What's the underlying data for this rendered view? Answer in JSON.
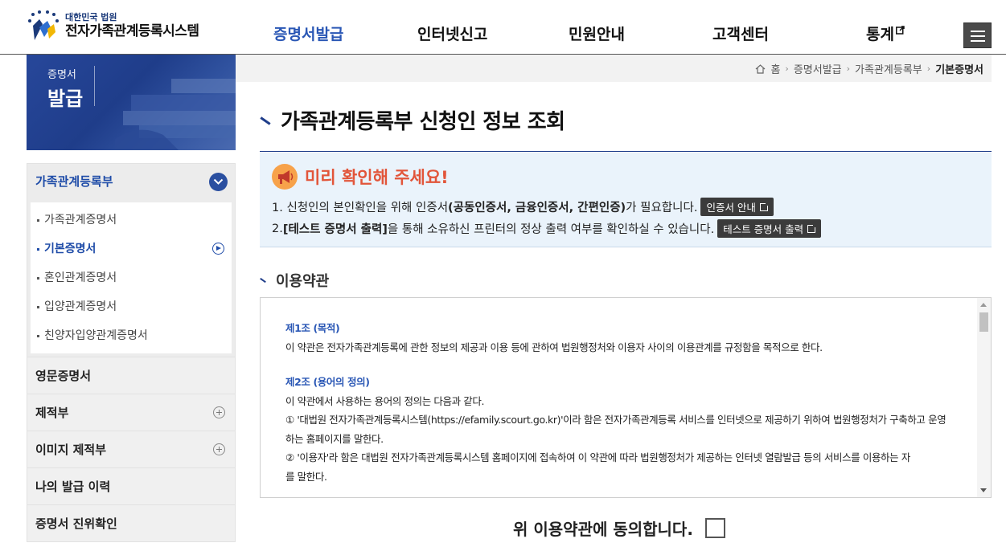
{
  "header": {
    "logo_small": "대한민국 법원",
    "logo_big": "전자가족관계등록시스템",
    "nav": [
      "증명서발급",
      "인터넷신고",
      "민원안내",
      "고객센터",
      "통계"
    ],
    "nav_active": "증명서발급",
    "menu_icon": "hamburger-icon"
  },
  "sidebar": {
    "banner_small": "증명서",
    "banner_big": "발급",
    "group_title": "가족관계등록부",
    "sub_items": [
      "가족관계증명서",
      "기본증명서",
      "혼인관계증명서",
      "입양관계증명서",
      "친양자입양관계증명서"
    ],
    "sub_active": "기본증명서",
    "links": [
      "영문증명서",
      "제적부",
      "이미지 제적부",
      "나의 발급 이력",
      "증명서 진위확인"
    ]
  },
  "breadcrumb": {
    "home": "홈",
    "items": [
      "증명서발급",
      "가족관계등록부"
    ],
    "current": "기본증명서"
  },
  "main": {
    "title": "가족관계등록부 신청인 정보 조회",
    "notice": {
      "title": "미리 확인해 주세요!",
      "line1_prefix": "1. 신청인의 본인확인을 위해 인증서",
      "line1_bold": "(공동인증서, 금융인증서, 간편인증)",
      "line1_suffix": "가 필요합니다.",
      "line1_button": "인증서 안내",
      "line2_prefix": "2. ",
      "line2_bold": "[테스트 증명서 출력]",
      "line2_suffix": "을 통해 소유하신 프린터의 정상 출력 여부를 확인하실 수 있습니다.",
      "line2_button": "테스트 증명서 출력"
    },
    "terms_title": "이용약관",
    "terms": {
      "art1_head": "제1조 (목적)",
      "art1_body": "이 약관은 전자가족관계등록에 관한 정보의 제공과 이용 등에 관하여 법원행정처와 이용자 사이의 이용관계를 규정함을 목적으로 한다.",
      "art2_head": "제2조 (용어의 정의)",
      "art2_intro": "이 약관에서 사용하는 용어의 정의는 다음과 같다.",
      "art2_item1a": "① '대법원 전자가족관계등록시스템(https://efamily.scourt.go.kr)'이라 함은 전자가족관계등록 서비스를 인터넷으로 제공하기 위하여 법원행정처가 구축하고 운영",
      "art2_item1b": "하는 홈페이지를 말한다.",
      "art2_item2a": "② '이용자'라 함은 대법원 전자가족관계등록시스템 홈페이지에 접속하여 이 약관에 따라 법원행정처가 제공하는 인터넷 열람발급 등의 서비스를 이용하는 자",
      "art2_item2b": "를 말한다."
    },
    "agree_label": "위 이용약관에 동의합니다."
  },
  "colors": {
    "brand_blue": "#1f3d8a",
    "active_nav": "#2a57b5",
    "notice_title": "#e2553a",
    "notice_bg": "#eaf3fb"
  }
}
